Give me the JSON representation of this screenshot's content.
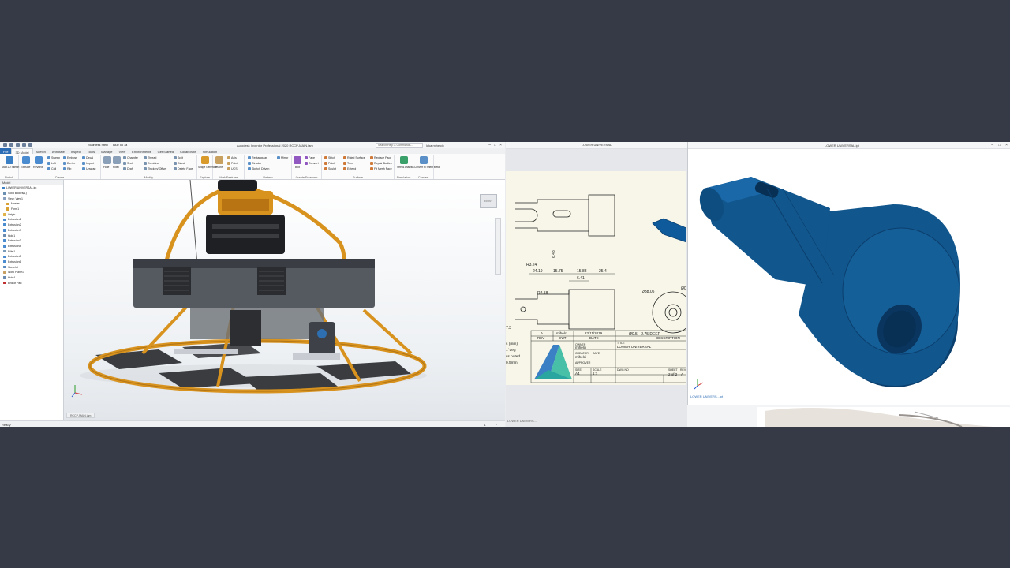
{
  "left_window": {
    "title": "Autodesk Inventor Professional 2020   RCCP-MAIN.iam",
    "material": "Stainless Steel",
    "appearance": "Blue 55 1a",
    "search_placeholder": "Search Help & Commands...",
    "user": "luka.mihelcic",
    "tabs": [
      "File",
      "3D Model",
      "Sketch",
      "Annotate",
      "Inspect",
      "Tools",
      "Manage",
      "View",
      "Environments",
      "Get Started",
      "Collaborate",
      "Simulation"
    ],
    "ribbon_groups": [
      {
        "label": "Sketch",
        "items": [
          "Start 2D Sketch"
        ]
      },
      {
        "label": "Create",
        "items": [
          "Extrude",
          "Revolve",
          "Sweep",
          "Loft",
          "Coil",
          "Emboss",
          "Derive",
          "Rib",
          "Decal",
          "Import",
          "Unwrap"
        ]
      },
      {
        "label": "Modify",
        "items": [
          "Hole",
          "Fillet",
          "Chamfer",
          "Shell",
          "Draft",
          "Thread",
          "Combine",
          "Thicken/ Offset",
          "Split",
          "Direct",
          "Delete Face"
        ]
      },
      {
        "label": "Explore",
        "items": [
          "Shape Generator"
        ]
      },
      {
        "label": "Work Features",
        "items": [
          "Plane",
          "Axis",
          "Point",
          "UCS"
        ]
      },
      {
        "label": "Pattern",
        "items": [
          "Rectangular",
          "Circular",
          "Sketch Driven",
          "Mirror"
        ]
      },
      {
        "label": "Create Freeform",
        "items": [
          "Box",
          "Face",
          "Convert"
        ]
      },
      {
        "label": "Surface",
        "items": [
          "Stitch",
          "Patch",
          "Sculpt",
          "Ruled Surface",
          "Trim",
          "Extend",
          "Replace Face",
          "Repair Bodies",
          "Fit Mesh Face"
        ]
      },
      {
        "label": "Simulation",
        "items": [
          "Stress Analysis"
        ]
      },
      {
        "label": "Convert",
        "items": [
          "Convert to Sheet Metal"
        ]
      }
    ],
    "browser": {
      "header": "Model",
      "items": [
        "LOWER UNIVERSAL.ipt",
        "Solid Bodies(1)",
        "View: View1",
        "Master",
        "Form1",
        "Origin",
        "Extrusion1",
        "Extrusion2",
        "Extrusion7",
        "Hole1",
        "Extrusion3",
        "Extrusion4",
        "Fillet1",
        "Extrusion5",
        "Extrusion6",
        "Sketch8",
        "Work Plane1",
        "Hole4",
        "End of Part"
      ]
    },
    "viewcube_label": "FRONT",
    "doc_tab": "RCCP-MAIN.iam",
    "status": {
      "text": "Ready",
      "num1": "1",
      "num2": "7"
    }
  },
  "middle_window": {
    "title": "LOWER UNIVERSAL",
    "dims": [
      "R3.24",
      "24.19",
      "15.75",
      "15.88",
      "25.4",
      "6.41",
      "6.48",
      "R2.18",
      "7.3",
      "Ø38.05",
      "Ø0.5 - 2.75 DEEP",
      "Ø0"
    ],
    "notes": [
      "s (mm).",
      "1°deg",
      "ss noted.",
      "0.5mm"
    ],
    "title_block": {
      "rev": "A",
      "init_val": "mihelci",
      "date_val": "23/11/2019",
      "rev_label": "REV",
      "init_label": "INIT",
      "date_label": "DATE",
      "desc_label": "DESCRIPTION",
      "owner_label": "OWNER",
      "owner": "mihelci",
      "creator_label": "CREATOR",
      "date_label2": "DATE",
      "creator": "mihelci",
      "approver_label": "APPROVER",
      "title_label": "TITLE",
      "title": "LOWER UNIVERSAL",
      "size_label": "SIZE",
      "size": "A4",
      "scale_label": "SCALE",
      "scale": "1:1",
      "dwg_label": "DWG NO",
      "sheet_label": "SHEET",
      "rev2_label": "REV",
      "sheet": "2 of 2",
      "rev2": "A"
    },
    "bottom_tab": "LOWER UNIVERS..."
  },
  "right_window": {
    "title": "LOWER UNIVERSAL.ipt",
    "bottom_tab": "LOWER UNIVERS...ipt",
    "part_color": "#11568c"
  }
}
